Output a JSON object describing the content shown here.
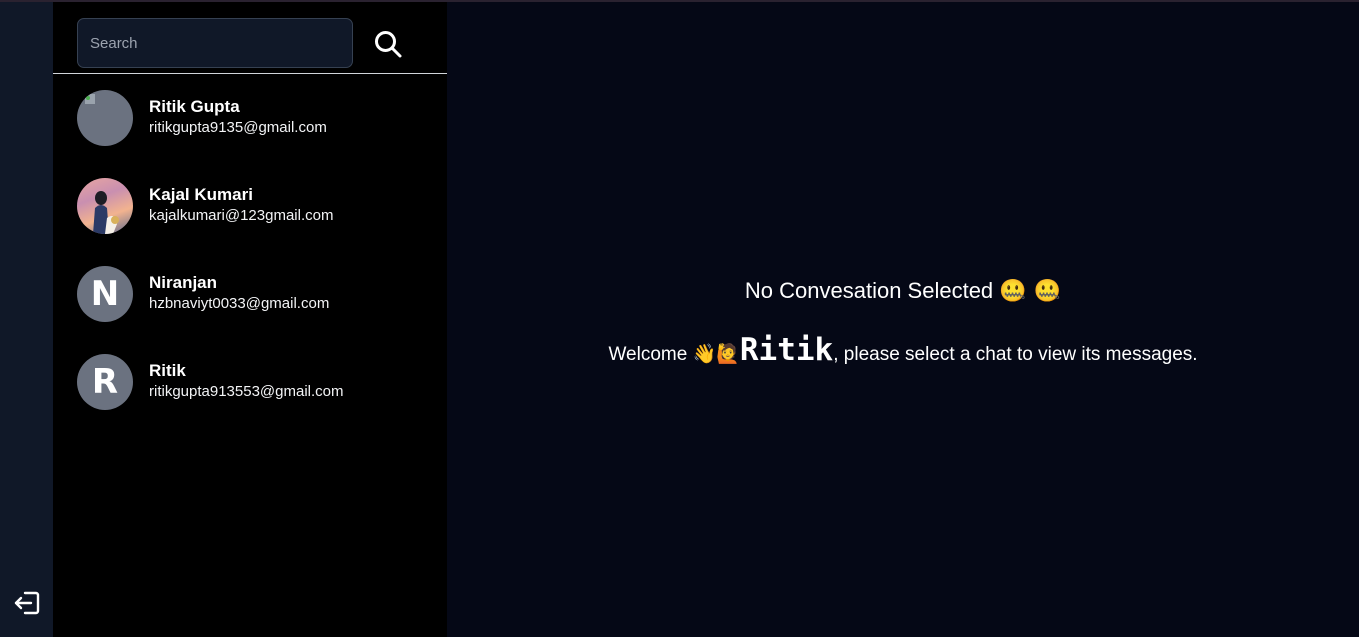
{
  "search": {
    "placeholder": "Search"
  },
  "contacts": [
    {
      "name": "Ritik Gupta",
      "email": "ritikgupta9135@gmail.com",
      "avatar_initial": ""
    },
    {
      "name": "Kajal Kumari",
      "email": "kajalkumari@123gmail.com",
      "avatar_initial": ""
    },
    {
      "name": "Niranjan",
      "email": "hzbnaviyt0033@gmail.com",
      "avatar_initial": "N"
    },
    {
      "name": "Ritik",
      "email": "ritikgupta913553@gmail.com",
      "avatar_initial": "R"
    }
  ],
  "main": {
    "empty_title": "No Convesation Selected",
    "empty_title_emoji": "🤐 🤐",
    "welcome_prefix": "Welcome",
    "welcome_emoji": "👋🙋",
    "welcome_name": "Ritik",
    "welcome_suffix": ", please select a chat to view its messages."
  },
  "icons": {
    "search": "search-icon",
    "logout": "logout-icon"
  },
  "colors": {
    "rail": "#101828",
    "sidebar": "#000000",
    "main": "#050816",
    "avatar": "#6b7280"
  }
}
